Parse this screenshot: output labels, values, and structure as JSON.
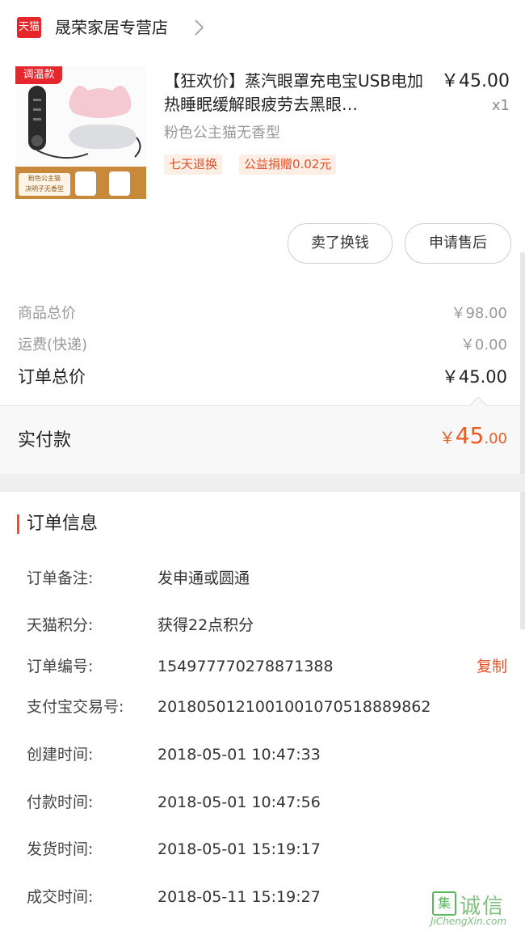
{
  "store": {
    "logo_text": "天猫",
    "name": "晟荣家居专营店"
  },
  "product": {
    "image_badge": "调温款",
    "image_tag": "粉色公主猫\n决明子无香型",
    "title": "【狂欢价】蒸汽眼罩充电宝USB电加热睡眠缓解眼疲劳去黑眼…",
    "price": "￥45.00",
    "quantity": "x1",
    "sku": "粉色公主猫无香型",
    "promos": [
      "七天退换",
      "公益捐赠0.02元"
    ],
    "actions": [
      "卖了换钱",
      "申请售后"
    ]
  },
  "summary": {
    "goods_total_label": "商品总价",
    "goods_total_value": "￥98.00",
    "shipping_label": "运费(快递)",
    "shipping_value": "￥0.00",
    "order_total_label": "订单总价",
    "order_total_value": "￥45.00",
    "paid_label": "实付款",
    "paid_currency": "￥",
    "paid_int": "45",
    "paid_dec": ".00"
  },
  "order_info": {
    "title": "订单信息",
    "copy_label": "复制",
    "rows": [
      {
        "key": "订单备注:",
        "value": "发申通或圆通"
      },
      {
        "key": "天猫积分:",
        "value": "获得22点积分"
      },
      {
        "key": "订单编号:",
        "value": "154977770278871388"
      },
      {
        "key": "支付宝交易号:",
        "value": "2018050121001001070518889862"
      },
      {
        "key": "创建时间:",
        "value": "2018-05-01 10:47:33"
      },
      {
        "key": "付款时间:",
        "value": "2018-05-01 10:47:56"
      },
      {
        "key": "发货时间:",
        "value": "2018-05-01 15:19:17"
      },
      {
        "key": "成交时间:",
        "value": "2018-05-11 15:19:27"
      }
    ]
  },
  "watermark": {
    "mark": "集",
    "chinese": "诚信",
    "url": "JiChengXin.com"
  },
  "colors": {
    "accent": "#e8512a",
    "price": "#f15a22",
    "tmall_red": "#e5262a"
  }
}
